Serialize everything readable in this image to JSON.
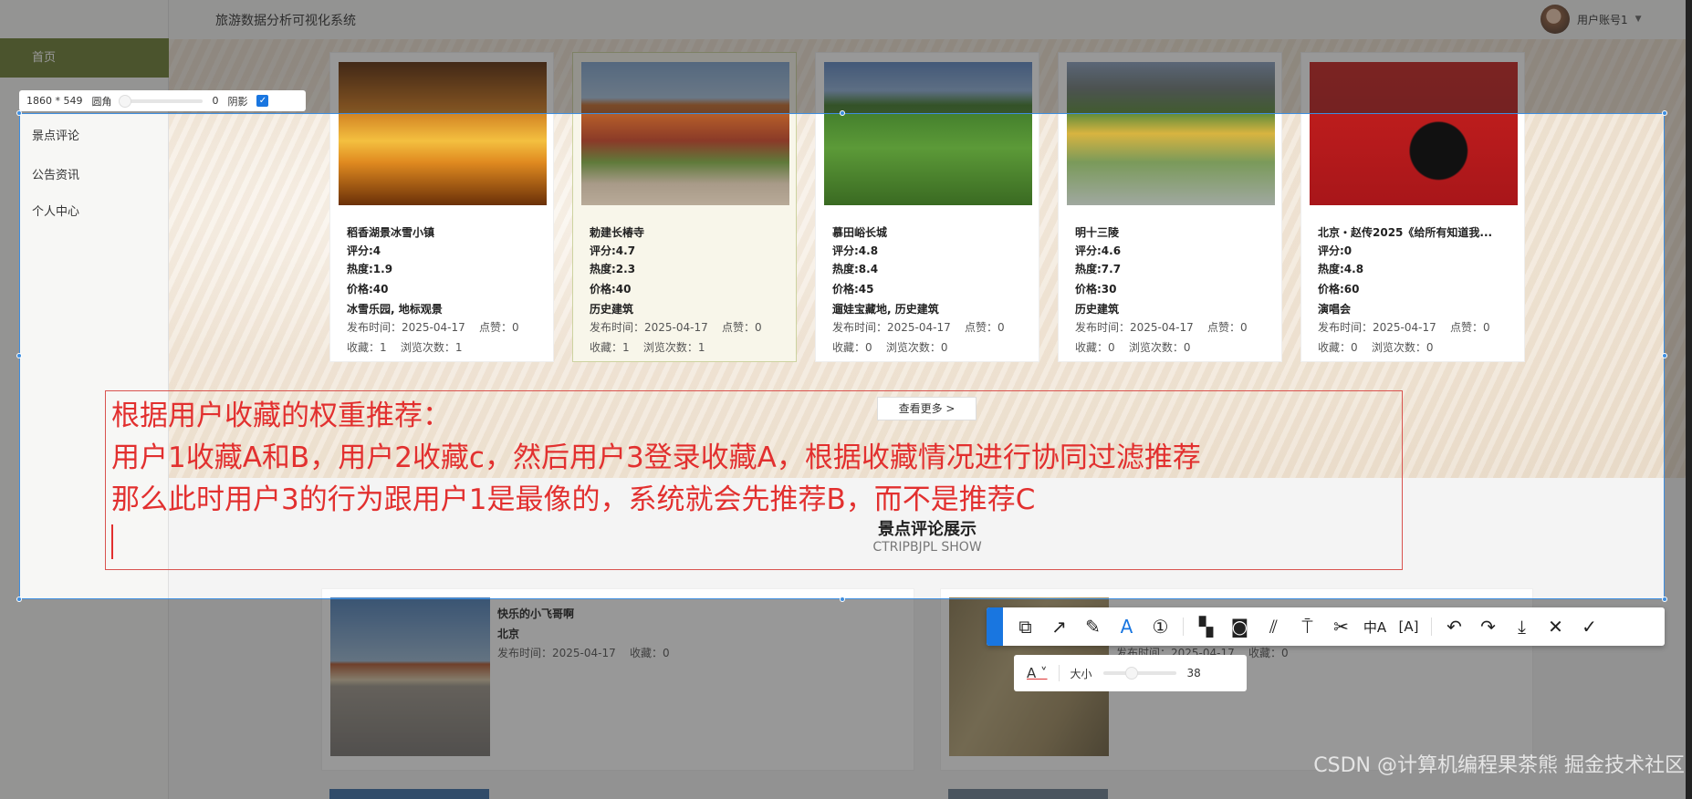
{
  "header": {
    "title": "旅游数据分析可视化系统",
    "user": "用户账号1"
  },
  "sidebar": {
    "items": [
      {
        "label": "首页"
      },
      {
        "label": "景点评论"
      },
      {
        "label": "公告资讯"
      },
      {
        "label": "个人中心"
      }
    ]
  },
  "cards": [
    {
      "name": "稻香湖景冰雪小镇",
      "rating": "评分:4",
      "heat": "热度:1.9",
      "price": "价格:40",
      "tags": "冰雪乐园, 地标观景",
      "date": "发布时间：2025-04-17",
      "likes": "点赞：0",
      "fav": "收藏：1",
      "views": "浏览次数：1"
    },
    {
      "name": "勅建长椿寺",
      "rating": "评分:4.7",
      "heat": "热度:2.3",
      "price": "价格:40",
      "tags": "历史建筑",
      "date": "发布时间：2025-04-17",
      "likes": "点赞：0",
      "fav": "收藏：1",
      "views": "浏览次数：1"
    },
    {
      "name": "慕田峪长城",
      "rating": "评分:4.8",
      "heat": "热度:8.4",
      "price": "价格:45",
      "tags": "遛娃宝藏地, 历史建筑",
      "date": "发布时间：2025-04-17",
      "likes": "点赞：0",
      "fav": "收藏：0",
      "views": "浏览次数：0"
    },
    {
      "name": "明十三陵",
      "rating": "评分:4.6",
      "heat": "热度:7.7",
      "price": "价格:30",
      "tags": "历史建筑",
      "date": "发布时间：2025-04-17",
      "likes": "点赞：0",
      "fav": "收藏：0",
      "views": "浏览次数：0"
    },
    {
      "name": "北京・赵传2025《给所有知道我...",
      "rating": "评分:0",
      "heat": "热度:4.8",
      "price": "价格:60",
      "tags": "演唱会",
      "date": "发布时间：2025-04-17",
      "likes": "点赞：0",
      "fav": "收藏：0",
      "views": "浏览次数：0"
    }
  ],
  "more_button": "查看更多 >",
  "section": {
    "title": "景点评论展示",
    "subtitle": "CTRIPBJPL SHOW"
  },
  "comments": [
    {
      "user": "快乐的小飞哥啊",
      "city": "北京",
      "date": "发布时间：2025-04-17",
      "fav": "收藏：0"
    },
    {
      "date": "发布时间：2025-04-17",
      "fav": "收藏：0"
    }
  ],
  "screenshot_tool": {
    "size": "1860 * 549",
    "radius_label": "圆角",
    "radius_value": "0",
    "shadow_label": "阴影",
    "font_size_label": "大小",
    "font_size_value": "38",
    "text_color": "#e2302f",
    "tools": [
      "shape-icon",
      "arrow-icon",
      "pen-icon",
      "text-icon",
      "number-icon",
      "mosaic-icon",
      "blur-icon",
      "hatch-icon",
      "pin-icon",
      "cut-icon",
      "translate-icon",
      "ocr-icon",
      "undo-icon",
      "redo-icon",
      "download-icon",
      "close-icon",
      "confirm-icon"
    ]
  },
  "annotation": {
    "lines": [
      "根据用户收藏的权重推荐：",
      "用户1收藏A和B，用户2收藏c，然后用户3登录收藏A，根据收藏情况进行协同过滤推荐",
      "那么此时用户3的行为跟用户1是最像的，系统就会先推荐B，而不是推荐C"
    ]
  },
  "watermark": "CSDN @计算机编程果茶熊 掘金技术社区"
}
